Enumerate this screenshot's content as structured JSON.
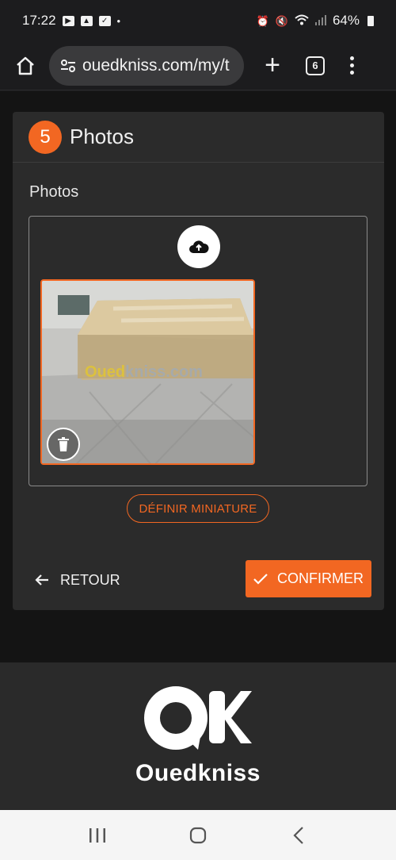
{
  "status": {
    "time": "17:22",
    "battery": "64%"
  },
  "browser": {
    "url": "ouedkniss.com/my/t",
    "tab_count": "6"
  },
  "step": {
    "number": "5",
    "title": "Photos"
  },
  "photos_section": {
    "label": "Photos",
    "watermark_a": "Oued",
    "watermark_b": "kniss.com"
  },
  "actions": {
    "set_thumbnail": "DÉFINIR MINIATURE",
    "back": "RETOUR",
    "confirm": "CONFIRMER"
  },
  "footer": {
    "brand": "Ouedkniss"
  },
  "colors": {
    "accent": "#f26722",
    "card": "#2b2b2b",
    "page": "#141414"
  },
  "icons": [
    "home-icon",
    "tune-icon",
    "plus-icon",
    "menu-icon",
    "cloud-upload-icon",
    "trash-icon",
    "arrow-left-icon",
    "check-icon",
    "recents-icon",
    "home-nav-icon",
    "back-nav-icon"
  ]
}
